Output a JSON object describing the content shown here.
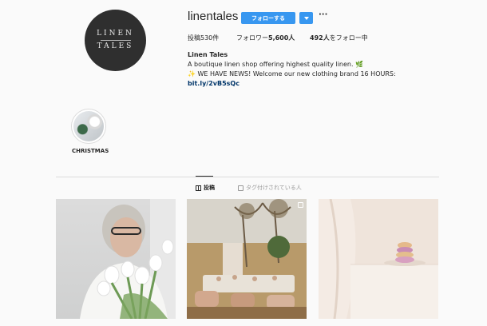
{
  "profile": {
    "username": "linentales",
    "logo_line1": "LINEN",
    "logo_line2": "TALES",
    "follow_label": "フォローする",
    "more_label": "···",
    "stats": {
      "posts": "投稿530件",
      "followers_prefix": "フォロワー",
      "followers_count": "5,600人",
      "following_count": "492人",
      "following_suffix": "をフォロー中"
    },
    "full_name": "Linen Tales",
    "bio_line1": "A boutique linen shop offering highest quality linen.",
    "bio_line1_emoji": "🌿",
    "bio_line2_emoji": "✨",
    "bio_line2": "WE HAVE NEWS! Welcome our new clothing brand 16 HOURS:",
    "bio_link": "bit.ly/2vB5sQc"
  },
  "highlights": [
    {
      "label": "CHRISTMAS"
    }
  ],
  "tabs": [
    {
      "label": "投稿",
      "active": true
    },
    {
      "label": "タグ付けされている人",
      "active": false
    }
  ],
  "colors": {
    "accent": "#3897f0",
    "link": "#003569",
    "background": "#fafafa"
  },
  "posts": [
    {
      "subject": "woman holding white tulips"
    },
    {
      "subject": "outdoor picnic table setting in field"
    },
    {
      "subject": "linen cloth with macarons"
    }
  ]
}
